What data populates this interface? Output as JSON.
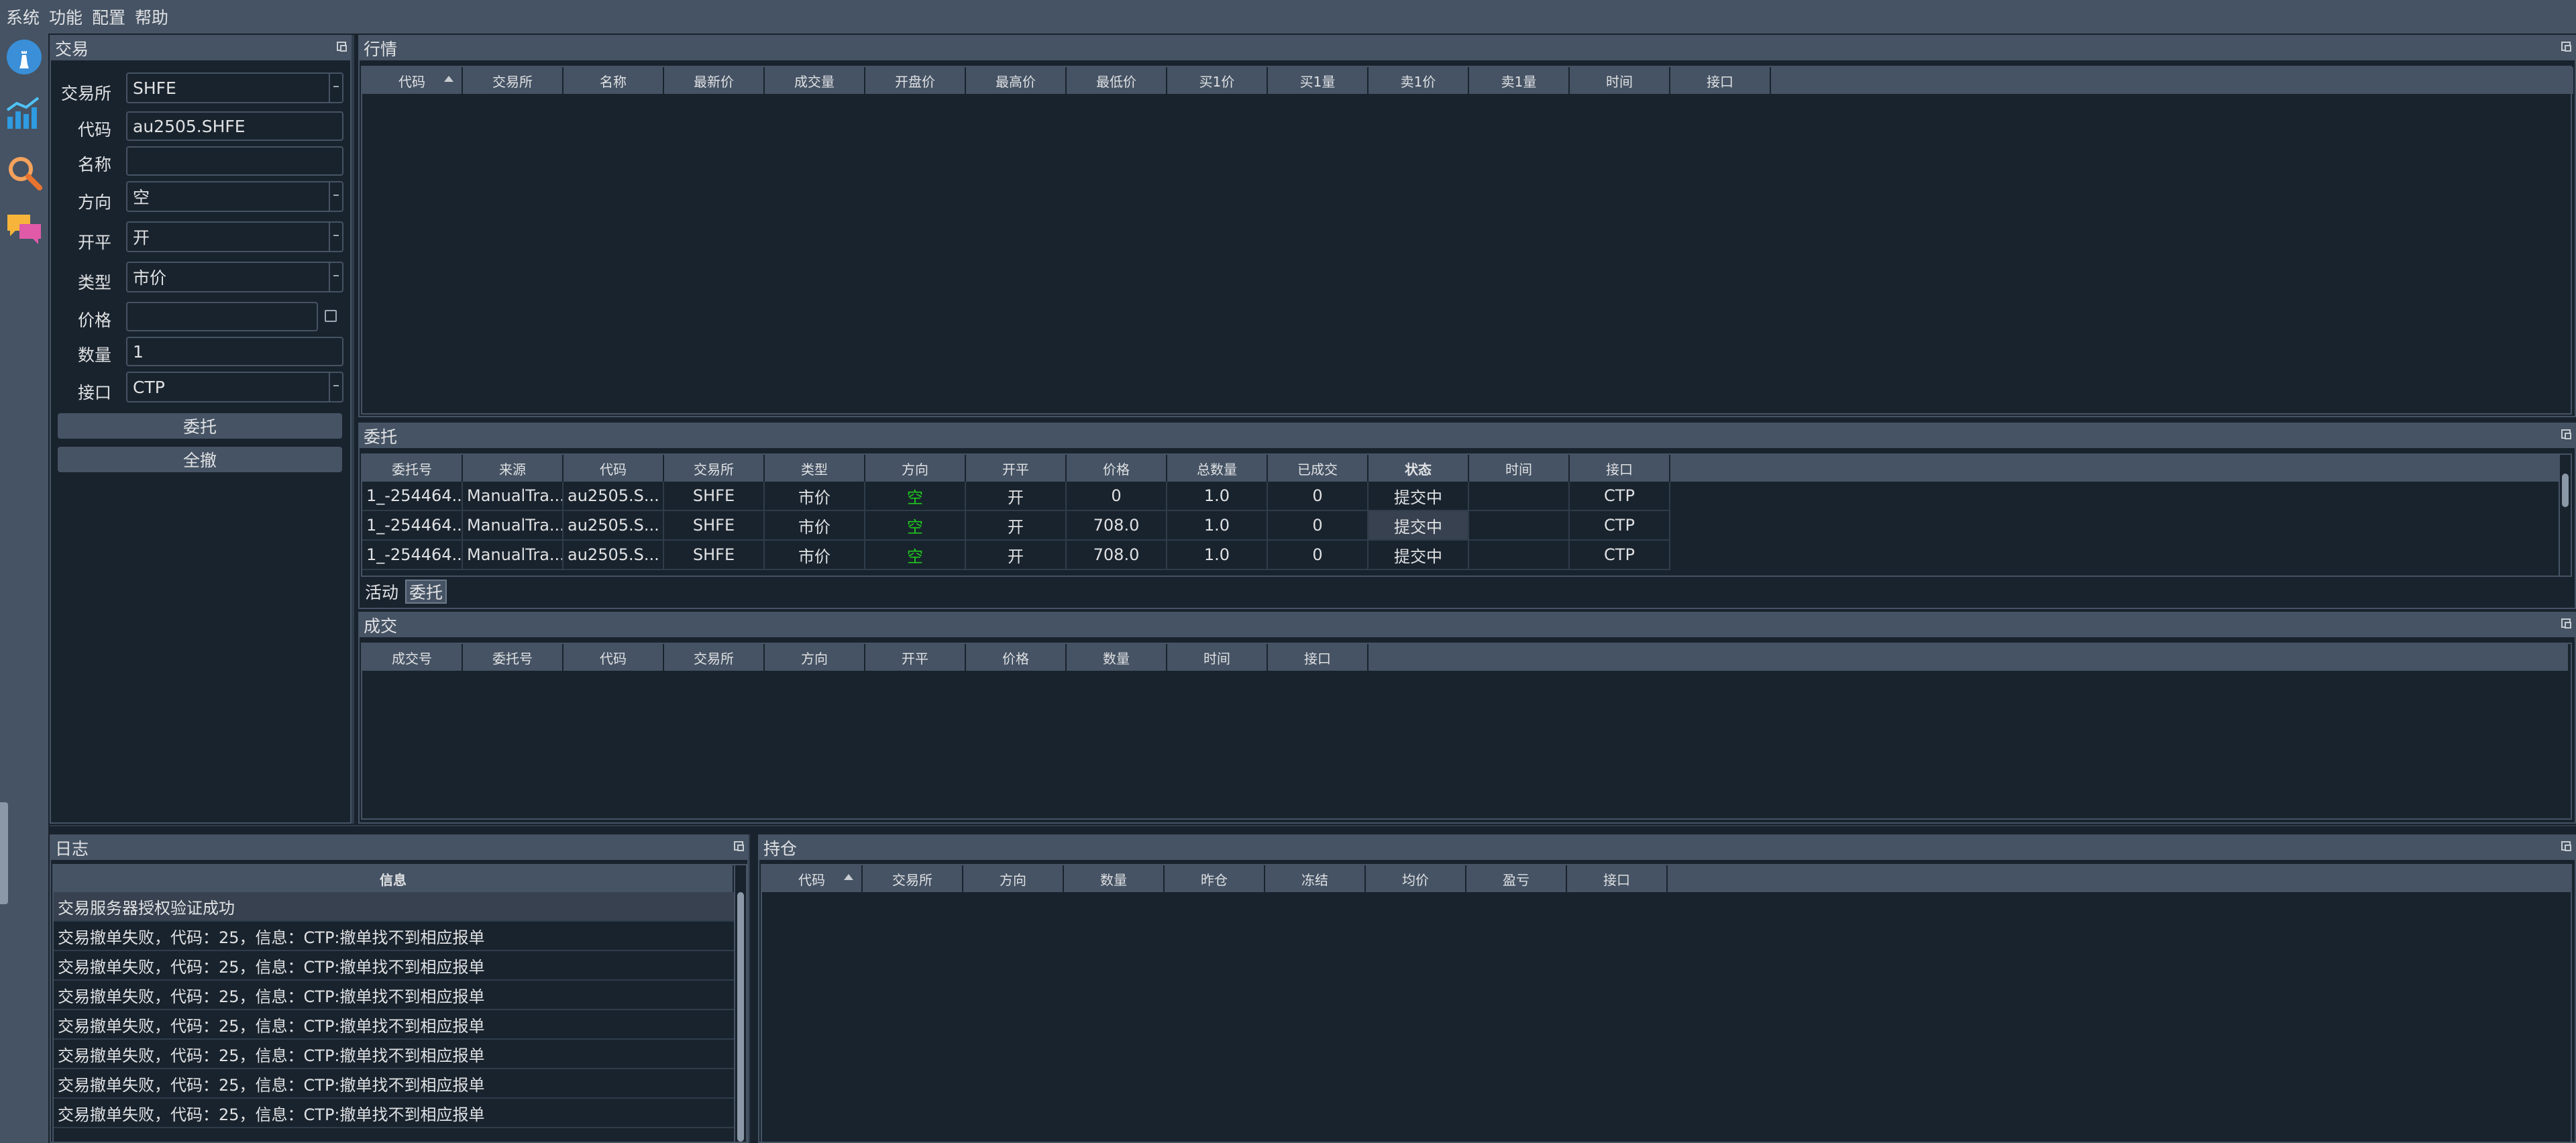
{
  "menu": [
    "系统",
    "功能",
    "配置",
    "帮助"
  ],
  "toolbar_icons": [
    "trade-chess-icon",
    "chart-bars-icon",
    "search-icon",
    "chat-icon"
  ],
  "trade_panel": {
    "title": "交易",
    "fields": {
      "exchange": {
        "label": "交易所",
        "value": "SHFE"
      },
      "symbol": {
        "label": "代码",
        "value": "au2505.SHFE"
      },
      "name": {
        "label": "名称",
        "value": ""
      },
      "direction": {
        "label": "方向",
        "value": "空"
      },
      "offset": {
        "label": "开平",
        "value": "开"
      },
      "type": {
        "label": "类型",
        "value": "市价"
      },
      "price": {
        "label": "价格",
        "value": ""
      },
      "volume": {
        "label": "数量",
        "value": "1"
      },
      "gateway": {
        "label": "接口",
        "value": "CTP"
      }
    },
    "buttons": {
      "send": "委托",
      "cancel_all": "全撤"
    }
  },
  "market_panel": {
    "title": "行情",
    "columns": [
      "代码",
      "交易所",
      "名称",
      "最新价",
      "成交量",
      "开盘价",
      "最高价",
      "最低价",
      "买1价",
      "买1量",
      "卖1价",
      "卖1量",
      "时间",
      "接口"
    ]
  },
  "order_panel": {
    "title": "委托",
    "columns": [
      "委托号",
      "来源",
      "代码",
      "交易所",
      "类型",
      "方向",
      "开平",
      "价格",
      "总数量",
      "已成交",
      "状态",
      "时间",
      "接口"
    ],
    "rows": [
      [
        "1_-254464...",
        "ManualTra...",
        "au2505.S...",
        "SHFE",
        "市价",
        "空",
        "开",
        "0",
        "1.0",
        "0",
        "提交中",
        "",
        "CTP"
      ],
      [
        "1_-254464...",
        "ManualTra...",
        "au2505.S...",
        "SHFE",
        "市价",
        "空",
        "开",
        "708.0",
        "1.0",
        "0",
        "提交中",
        "",
        "CTP"
      ],
      [
        "1_-254464...",
        "ManualTra...",
        "au2505.S...",
        "SHFE",
        "市价",
        "空",
        "开",
        "708.0",
        "1.0",
        "0",
        "提交中",
        "",
        "CTP"
      ]
    ],
    "tabs": [
      "活动",
      "委托"
    ],
    "direction_color": "#1ec81e"
  },
  "trade_record_panel": {
    "title": "成交",
    "columns": [
      "成交号",
      "委托号",
      "代码",
      "交易所",
      "方向",
      "开平",
      "价格",
      "数量",
      "时间",
      "接口"
    ]
  },
  "log_panel": {
    "title": "日志",
    "column": "信息",
    "rows": [
      "交易服务器授权验证成功",
      "交易撤单失败，代码：25，信息：CTP:撤单找不到相应报单",
      "交易撤单失败，代码：25，信息：CTP:撤单找不到相应报单",
      "交易撤单失败，代码：25，信息：CTP:撤单找不到相应报单",
      "交易撤单失败，代码：25，信息：CTP:撤单找不到相应报单",
      "交易撤单失败，代码：25，信息：CTP:撤单找不到相应报单",
      "交易撤单失败，代码：25，信息：CTP:撤单找不到相应报单",
      "交易撤单失败，代码：25，信息：CTP:撤单找不到相应报单"
    ]
  },
  "position_panel": {
    "title": "持仓",
    "columns": [
      "代码",
      "交易所",
      "方向",
      "数量",
      "昨仓",
      "冻结",
      "均价",
      "盈亏",
      "接口"
    ]
  },
  "colors": {
    "background": "#19232d",
    "panel_header": "#455364",
    "text": "#e0e1e3",
    "accent": "#1ec81e"
  }
}
